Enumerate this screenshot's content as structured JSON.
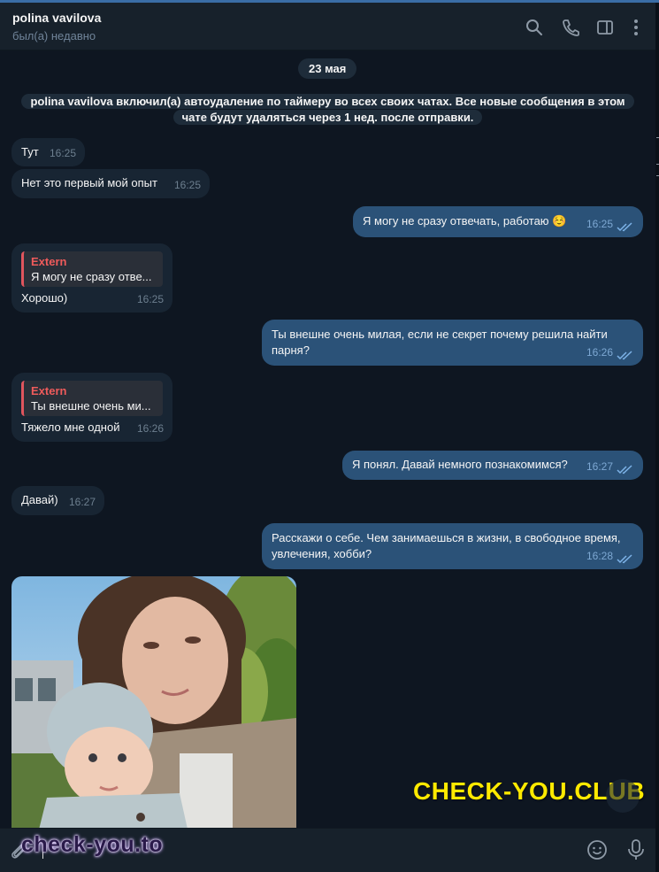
{
  "header": {
    "contact_name": "polina vavilova",
    "status": "был(а) недавно",
    "icons": [
      "search-icon",
      "phone-icon",
      "sidebar-toggle-icon",
      "more-vertical-icon"
    ]
  },
  "chat": {
    "date": "23 мая",
    "service_message": "polina vavilova включил(а) автоудаление по таймеру во всех своих чатах. Все новые сообщения в этом чате будут удаляться через 1 нед. после отправки.",
    "messages": [
      {
        "dir": "in",
        "text": "Тут",
        "time": "16:25"
      },
      {
        "dir": "in",
        "text": "Нет это первый мой опыт",
        "time": "16:25"
      },
      {
        "dir": "out",
        "text": "Я могу не сразу отвечать, работаю ☺️",
        "time": "16:25",
        "read": true
      },
      {
        "dir": "in",
        "reply_name": "Extern",
        "reply_text": "Я могу не сразу отве...",
        "text": "Хорошо)",
        "time": "16:25"
      },
      {
        "dir": "out",
        "text": "Ты внешне очень милая, если не секрет почему решила найти парня?",
        "time": "16:26",
        "read": true
      },
      {
        "dir": "in",
        "reply_name": "Extern",
        "reply_text": "Ты внешне очень ми...",
        "text": "Тяжело мне одной",
        "time": "16:26"
      },
      {
        "dir": "out",
        "text": "Я понял. Давай немного познакомимся?",
        "time": "16:27",
        "read": true
      },
      {
        "dir": "in",
        "text": "Давай)",
        "time": "16:27"
      },
      {
        "dir": "out",
        "text": "Расскажи о себе. Чем занимаешься в жизни, в свободное время, увлечения, хобби?",
        "time": "16:28",
        "read": true
      }
    ]
  },
  "watermarks": {
    "top": "CHECK-YOU.CLUB",
    "bottom": "check-you.to"
  },
  "composer": {
    "icons": [
      "attach-icon",
      "emoji-icon",
      "microphone-icon"
    ]
  },
  "colors": {
    "background": "#0e1621",
    "incoming_bubble": "#182533",
    "outgoing_bubble": "#2b5278",
    "reply_accent": "#ef5b5b",
    "watermark_yellow": "#ffea00"
  }
}
